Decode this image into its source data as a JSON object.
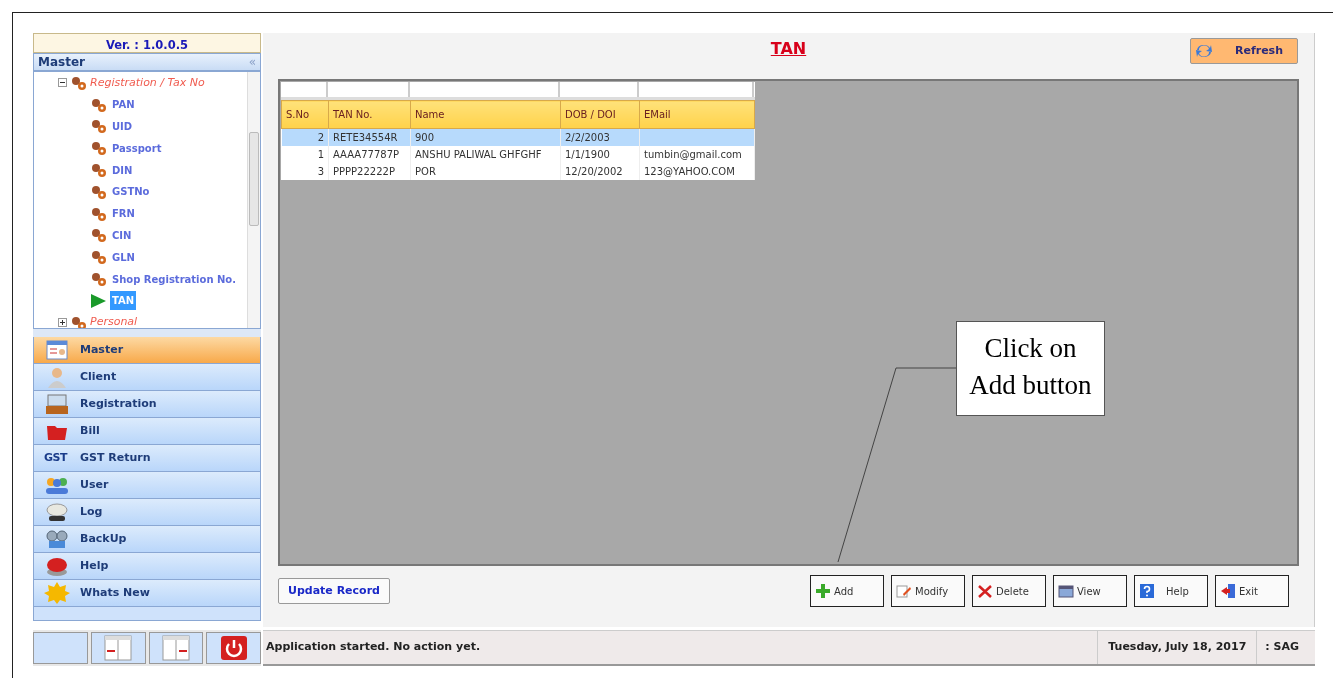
{
  "sidebar": {
    "version": "Ver. : 1.0.0.5",
    "panel_title": "Master",
    "collapse_glyph": "«",
    "tree": [
      {
        "label": "Registration / Tax No",
        "expanded": true,
        "children": [
          {
            "label": "PAN",
            "selected": false
          },
          {
            "label": "UID",
            "selected": false
          },
          {
            "label": "Passport",
            "selected": false
          },
          {
            "label": "DIN",
            "selected": false
          },
          {
            "label": "GSTNo",
            "selected": false
          },
          {
            "label": "FRN",
            "selected": false
          },
          {
            "label": "CIN",
            "selected": false
          },
          {
            "label": "GLN",
            "selected": false
          },
          {
            "label": "Shop Registration No.",
            "selected": false
          },
          {
            "label": "TAN",
            "selected": true
          }
        ]
      },
      {
        "label": "Personal",
        "expanded": false
      }
    ],
    "nav": [
      {
        "label": "Master",
        "selected": true
      },
      {
        "label": "Client",
        "selected": false
      },
      {
        "label": "Registration",
        "selected": false
      },
      {
        "label": "Bill",
        "selected": false
      },
      {
        "label": "GST Return",
        "selected": false,
        "logo_text": "GST"
      },
      {
        "label": "User",
        "selected": false
      },
      {
        "label": "Log",
        "selected": false
      },
      {
        "label": "BackUp",
        "selected": false
      },
      {
        "label": "Help",
        "selected": false
      },
      {
        "label": "Whats New",
        "selected": false
      }
    ]
  },
  "main": {
    "title": "TAN",
    "refresh": "Refresh",
    "table": {
      "columns": [
        "S.No",
        "TAN No.",
        "Name",
        "DOB / DOI",
        "EMail"
      ],
      "rows": [
        {
          "cells": [
            "2",
            "RETE34554R",
            "900",
            "2/2/2003",
            ""
          ],
          "selected": true
        },
        {
          "cells": [
            "1",
            "AAAA77787P",
            "ANSHU PALIWAL GHFGHF",
            "1/1/1900",
            "tumbin@gmail.com"
          ],
          "selected": false
        },
        {
          "cells": [
            "3",
            "PPPP22222P",
            "POR",
            "12/20/2002",
            "123@YAHOO.COM"
          ],
          "selected": false
        }
      ]
    },
    "update_button": "Update Record",
    "actions": [
      "Add",
      "Modify",
      "Delete",
      "View",
      "Help",
      "Exit"
    ]
  },
  "callout": {
    "text": "Click on Add button"
  },
  "status_bar": {
    "message": "Application started. No action yet.",
    "date": "Tuesday, July 18, 2017",
    "user": ": SAG"
  }
}
